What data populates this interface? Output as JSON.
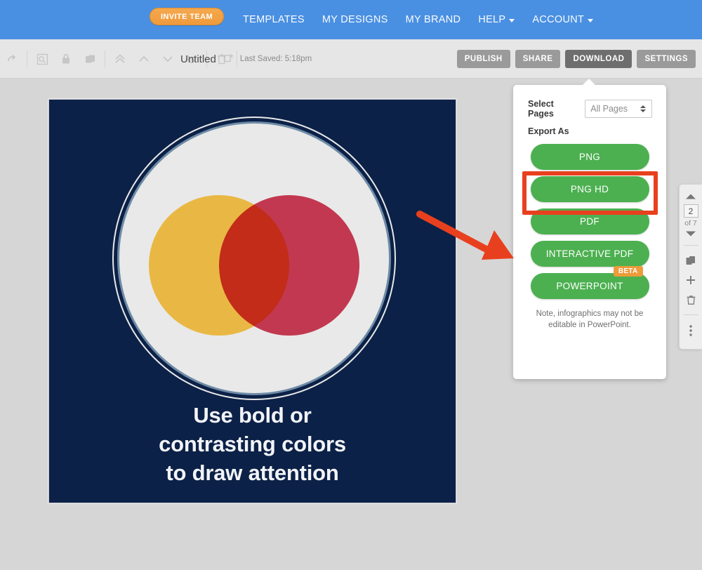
{
  "topnav": {
    "invite_label": "INVITE TEAM",
    "links": [
      {
        "label": "TEMPLATES",
        "caret": false
      },
      {
        "label": "MY DESIGNS",
        "caret": false
      },
      {
        "label": "MY BRAND",
        "caret": false
      },
      {
        "label": "HELP",
        "caret": true
      },
      {
        "label": "ACCOUNT",
        "caret": true
      }
    ]
  },
  "toolbar": {
    "icons": [
      "redo-icon",
      "crop-frame-icon",
      "lock-icon",
      "duplicate-icon",
      "move-to-front-icon",
      "move-up-icon",
      "move-down-icon",
      "move-to-back-icon",
      "trash-icon"
    ],
    "doc_name": "Untitled",
    "edit_icon": "edit-pencil-icon",
    "last_saved": "Last Saved: 5:18pm",
    "actions": [
      {
        "label": "PUBLISH",
        "active": false
      },
      {
        "label": "SHARE",
        "active": false
      },
      {
        "label": "DOWNLOAD",
        "active": true
      },
      {
        "label": "SETTINGS",
        "active": false
      }
    ]
  },
  "canvas": {
    "background_color": "#0c2147",
    "ring_color": "#6e8ba6",
    "inner_circle_color": "#e9e9e9",
    "venn_left_color": "#e8b02c",
    "venn_right_color": "#cf2240",
    "headline_line1": "Use bold or",
    "headline_line2": "contrasting colors",
    "headline_line3": "to draw attention"
  },
  "download_panel": {
    "select_pages_label": "Select Pages",
    "select_pages_value": "All Pages",
    "export_as_label": "Export As",
    "buttons": [
      {
        "label": "PNG",
        "badge": null
      },
      {
        "label": "PNG HD",
        "badge": null
      },
      {
        "label": "PDF",
        "badge": null
      },
      {
        "label": "INTERACTIVE PDF",
        "badge": null
      },
      {
        "label": "POWERPOINT",
        "badge": "BETA"
      }
    ],
    "note": "Note, infographics may not be editable in PowerPoint.",
    "highlight_color": "#e8401e",
    "button_color": "#4cb050",
    "badge_color": "#ee9b3a"
  },
  "annotation": {
    "arrow_color": "#e8401e",
    "points_to": "PNG HD"
  },
  "page_sidebar": {
    "up_icon": "chevron-up-icon",
    "page_number": "2",
    "page_total": "of 7",
    "down_icon": "chevron-down-icon",
    "duplicate_icon": "duplicate-page-icon",
    "add_icon": "add-page-icon",
    "delete_icon": "delete-page-icon",
    "more_icon": "more-options-icon"
  }
}
